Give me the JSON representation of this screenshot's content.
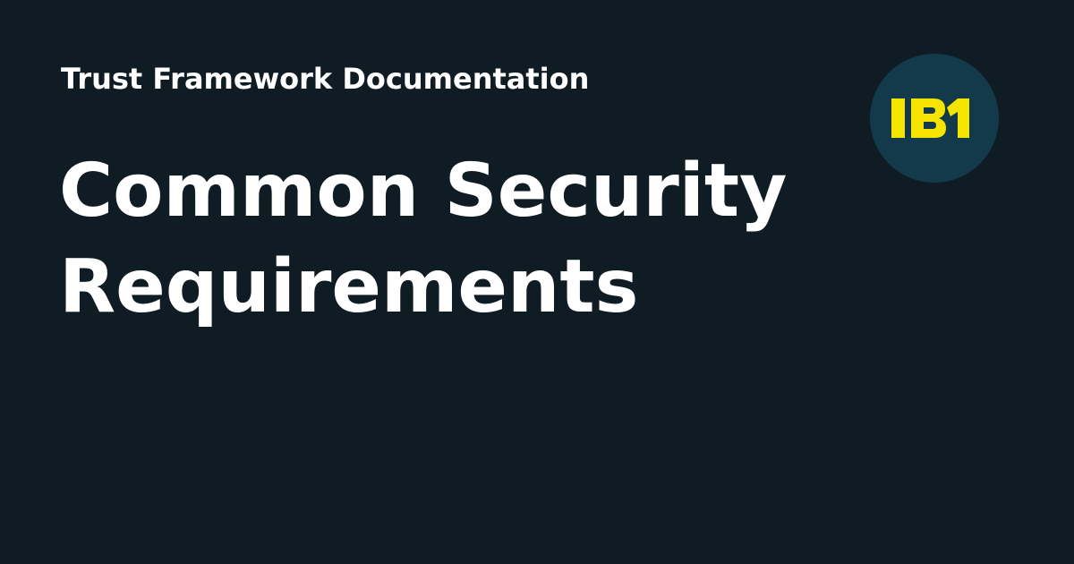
{
  "page": {
    "eyebrow": "Trust Framework Documentation",
    "title_line_1": "Common Security",
    "title_line_2": "Requirements"
  },
  "logo": {
    "text": "IB1",
    "background_color": "#123a4a",
    "text_color": "#f5e400"
  },
  "colors": {
    "background": "#0f1c24",
    "text": "#ffffff"
  }
}
